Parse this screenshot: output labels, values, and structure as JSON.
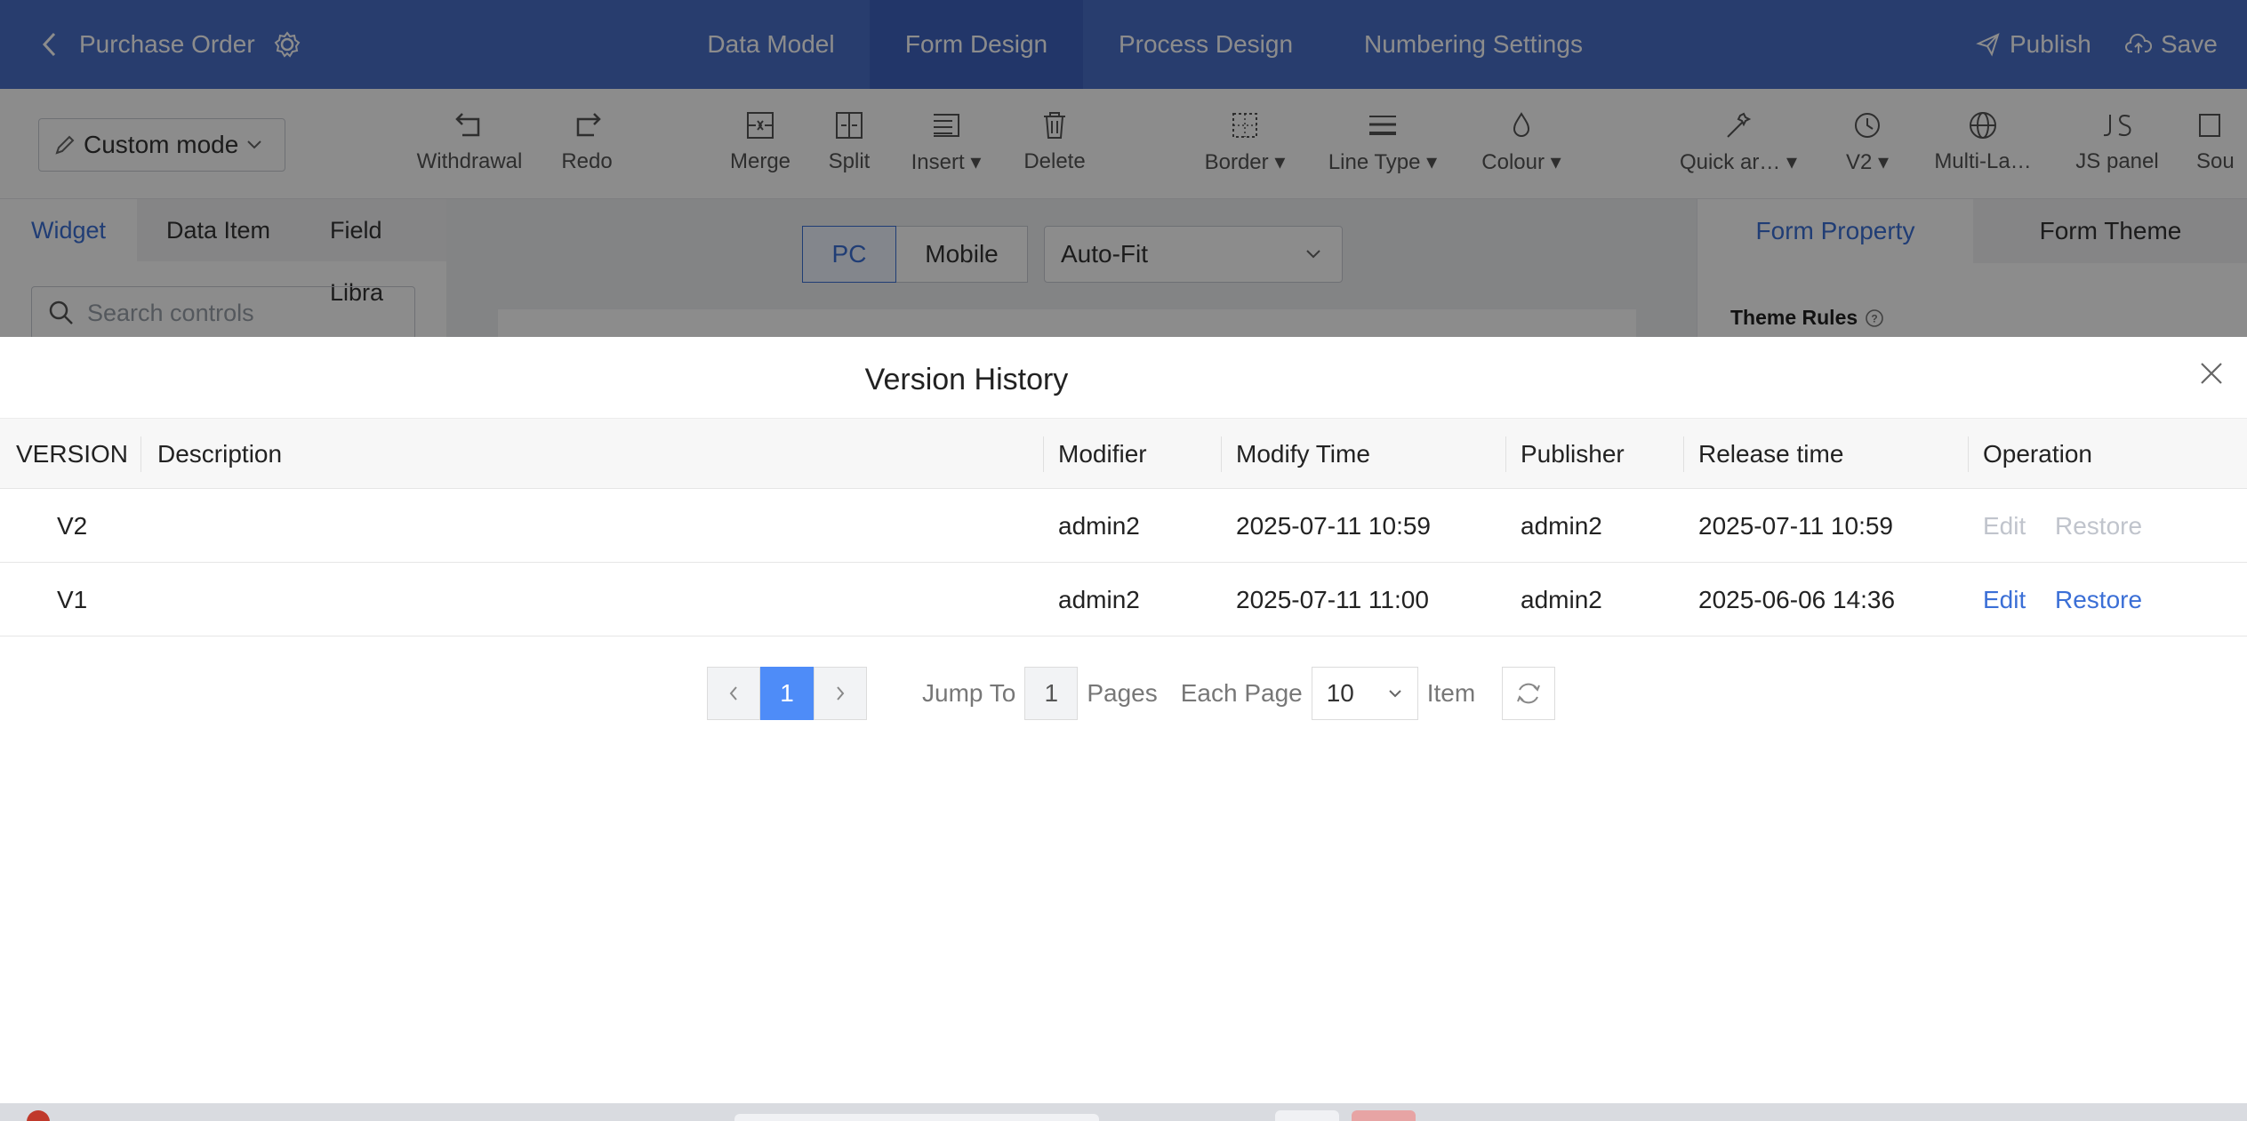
{
  "topnav": {
    "title": "Purchase Order",
    "tabs": [
      "Data Model",
      "Form Design",
      "Process Design",
      "Numbering Settings"
    ],
    "active_tab": "Form Design",
    "publish_label": "Publish",
    "save_label": "Save"
  },
  "toolbar": {
    "mode": "Custom mode",
    "tools": [
      {
        "label": "Withdrawal",
        "icon": "undo-icon"
      },
      {
        "label": "Redo",
        "icon": "redo-icon"
      },
      {
        "label": "Merge",
        "icon": "merge-icon"
      },
      {
        "label": "Split",
        "icon": "split-icon"
      },
      {
        "label": "Insert",
        "icon": "insert-icon"
      },
      {
        "label": "Delete",
        "icon": "trash-icon"
      },
      {
        "label": "Border",
        "icon": "border-icon"
      },
      {
        "label": "Line Type",
        "icon": "line-type-icon"
      },
      {
        "label": "Colour",
        "icon": "droplet-icon"
      },
      {
        "label": "Quick ar…",
        "icon": "magic-wand-icon"
      },
      {
        "label": "V2",
        "icon": "clock-icon"
      },
      {
        "label": "Multi-La…",
        "icon": "globe-icon"
      },
      {
        "label": "JS panel",
        "icon": "js-icon"
      },
      {
        "label": "Sou",
        "icon": "source-icon"
      }
    ]
  },
  "left_panel": {
    "tabs": [
      "Widget",
      "Data Item",
      "Field Libra"
    ],
    "active_tab": "Widget",
    "search_placeholder": "Search controls"
  },
  "canvas": {
    "devices": [
      "PC",
      "Mobile"
    ],
    "active_device": "PC",
    "fit": "Auto-Fit"
  },
  "right_panel": {
    "tabs": [
      "Form Property",
      "Form Theme"
    ],
    "active_tab": "Form Property",
    "section": "Theme Rules"
  },
  "modal": {
    "title": "Version History",
    "columns": [
      "VERSION",
      "Description",
      "Modifier",
      "Modify Time",
      "Publisher",
      "Release time",
      "Operation"
    ],
    "rows": [
      {
        "version": "V2",
        "description": "",
        "modifier": "admin2",
        "modify_time": "2025-07-11 10:59",
        "publisher": "admin2",
        "release_time": "2025-07-11 10:59",
        "edit": "Edit",
        "restore": "Restore",
        "ops_enabled": false
      },
      {
        "version": "V1",
        "description": "",
        "modifier": "admin2",
        "modify_time": "2025-07-11 11:00",
        "publisher": "admin2",
        "release_time": "2025-06-06 14:36",
        "edit": "Edit",
        "restore": "Restore",
        "ops_enabled": true
      }
    ],
    "pagination": {
      "current_page": "1",
      "jump_label": "Jump To",
      "jump_value": "1",
      "pages_label": "Pages",
      "each_page_label": "Each Page",
      "page_size": "10",
      "item_label": "Item"
    }
  },
  "colors": {
    "nav_bg": "#4a6fc9",
    "accent": "#3b6fd6",
    "pager_active": "#4e8cf8",
    "disabled_text": "#c0c4cc"
  }
}
